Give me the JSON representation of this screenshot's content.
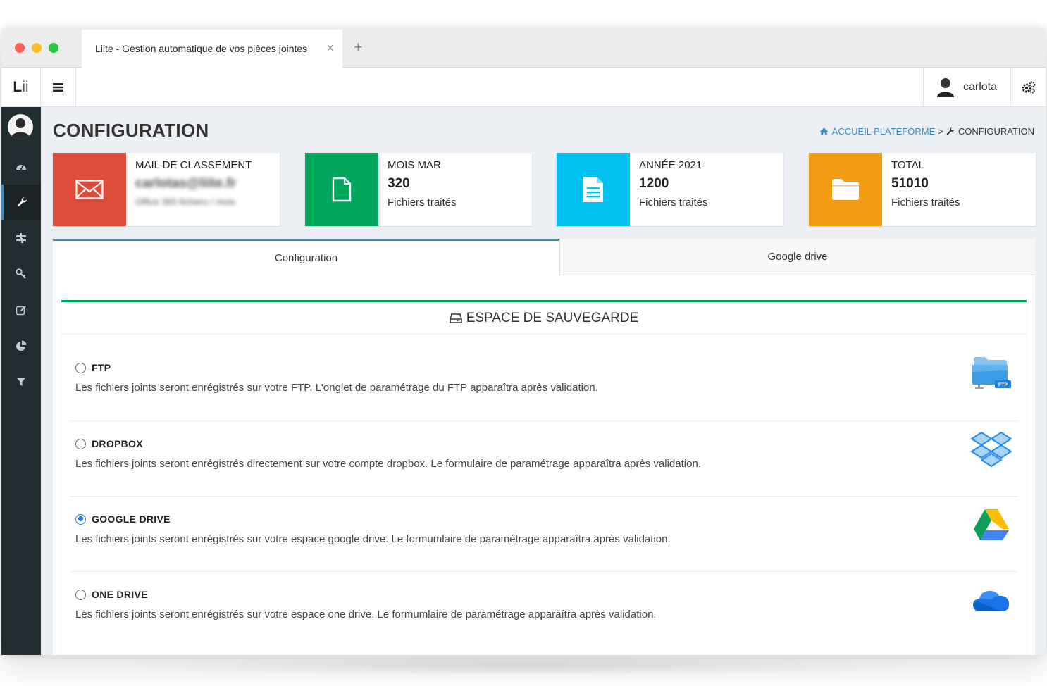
{
  "browser": {
    "tab_title": "Liite - Gestion automatique de vos pièces jointes",
    "close_symbol": "×",
    "new_tab_symbol": "+"
  },
  "header": {
    "logo_bold": "L",
    "logo_thin": "ii",
    "username": "carlota"
  },
  "sidebar": {
    "items": [
      {
        "icon": "dashboard-icon"
      },
      {
        "icon": "wrench-icon",
        "active": true
      },
      {
        "icon": "sliders-icon"
      },
      {
        "icon": "key-icon"
      },
      {
        "icon": "edit-icon"
      },
      {
        "icon": "pie-chart-icon"
      },
      {
        "icon": "filter-icon"
      }
    ]
  },
  "page": {
    "title": "CONFIGURATION",
    "breadcrumb": {
      "home": "ACCUEIL PLATEFORME",
      "separator": ">",
      "current": "CONFIGURATION"
    }
  },
  "stats": [
    {
      "label": "MAIL DE CLASSEMENT",
      "value": "carlotas@liite.fr",
      "sub": "Office 365 fichiers / mois",
      "color": "#dd4b39",
      "icon": "envelope-icon",
      "blurred": true
    },
    {
      "label": "MOIS MAR",
      "value": "320",
      "sub": "Fichiers traités",
      "color": "#00a65a",
      "icon": "file-icon"
    },
    {
      "label": "ANNÉE 2021",
      "value": "1200",
      "sub": "Fichiers traités",
      "color": "#00c0ef",
      "icon": "file-text-icon"
    },
    {
      "label": "TOTAL",
      "value": "51010",
      "sub": "Fichiers traités",
      "color": "#f39c12",
      "icon": "folder-icon"
    }
  ],
  "tabs": [
    {
      "label": "Configuration",
      "active": true
    },
    {
      "label": "Google drive",
      "active": false
    }
  ],
  "storage": {
    "title": "ESPACE DE SAUVEGARDE",
    "options": [
      {
        "name": "FTP",
        "description": "Les fichiers joints seront enrégistrés sur votre FTP. L'onglet de paramétrage du FTP apparaîtra après validation.",
        "checked": false,
        "icon": "ftp-folder-icon",
        "icon_badge": "FTP"
      },
      {
        "name": "DROPBOX",
        "description": "Les fichiers joints seront enrégistrés directement sur votre compte dropbox. Le formulaire de paramétrage apparaîtra après validation.",
        "checked": false,
        "icon": "dropbox-icon"
      },
      {
        "name": "GOOGLE DRIVE",
        "description": "Les fichiers joints seront enrégistrés sur votre espace google drive. Le formumlaire de paramétrage apparaîtra après validation.",
        "checked": true,
        "icon": "google-drive-icon"
      },
      {
        "name": "ONE DRIVE",
        "description": "Les fichiers joints seront enrégistrés sur votre espace one drive. Le formumlaire de paramétrage apparaîtra après validation.",
        "checked": false,
        "icon": "onedrive-icon"
      }
    ]
  }
}
